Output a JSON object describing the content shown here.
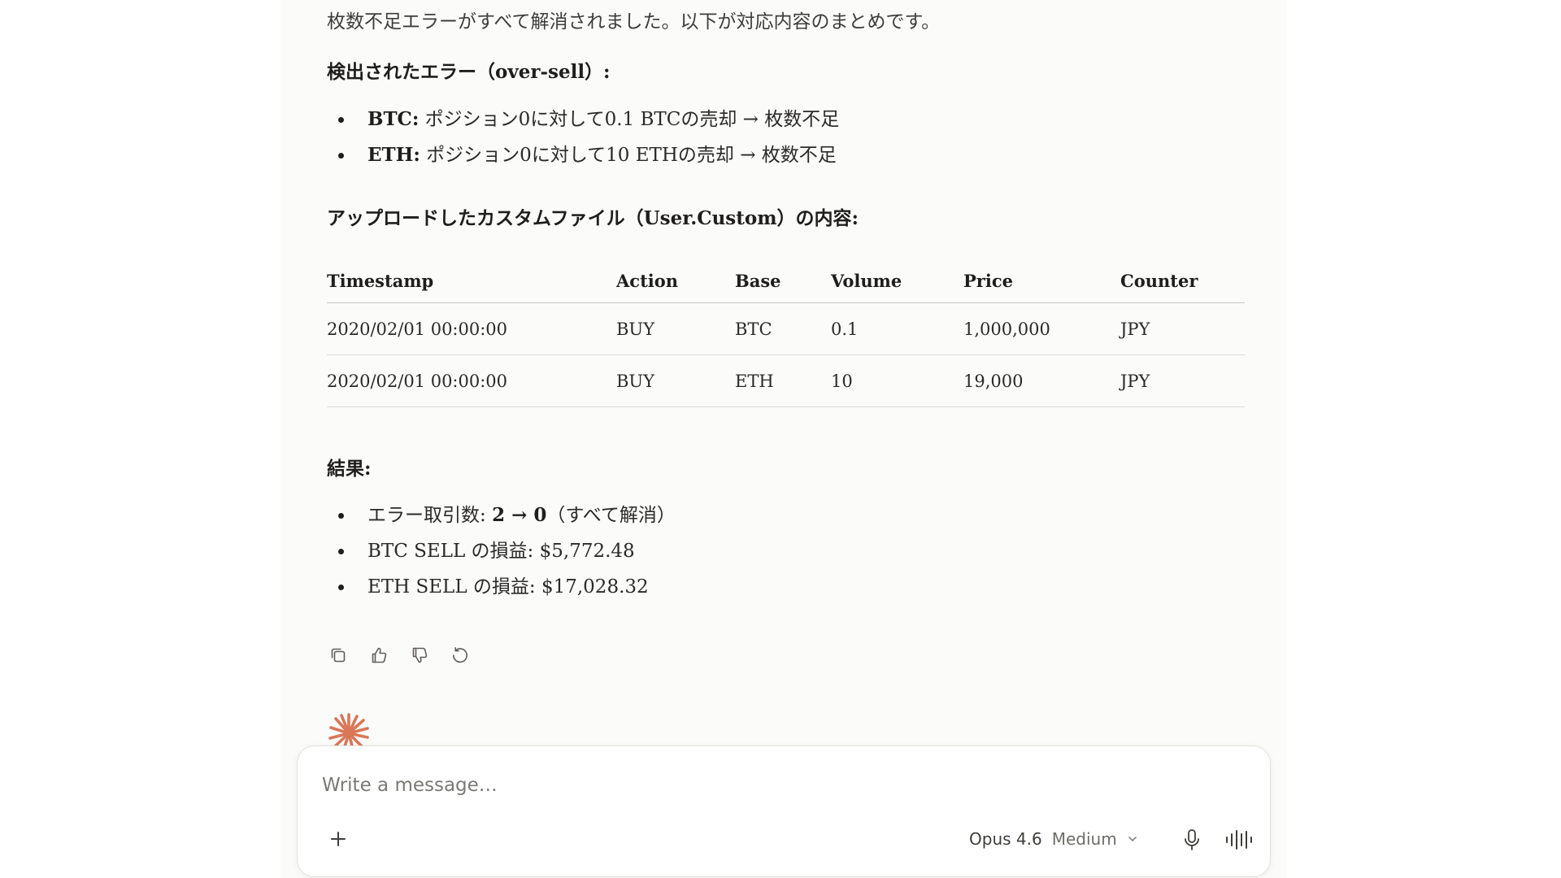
{
  "message": {
    "intro": "枚数不足エラーがすべて解消されました。以下が対応内容のまとめです。",
    "errors_heading": "検出されたエラー（over-sell）:",
    "errors": [
      {
        "label": "BTC:",
        "text": " ポジション0に対して0.1 BTCの売却 → 枚数不足"
      },
      {
        "label": "ETH:",
        "text": " ポジション0に対して10 ETHの売却 → 枚数不足"
      }
    ],
    "upload_heading": "アップロードしたカスタムファイル（User.Custom）の内容:",
    "table": {
      "headers": [
        "Timestamp",
        "Action",
        "Base",
        "Volume",
        "Price",
        "Counter"
      ],
      "rows": [
        [
          "2020/02/01 00:00:00",
          "BUY",
          "BTC",
          "0.1",
          "1,000,000",
          "JPY"
        ],
        [
          "2020/02/01 00:00:00",
          "BUY",
          "ETH",
          "10",
          "19,000",
          "JPY"
        ]
      ]
    },
    "result_heading": "結果:",
    "results": [
      {
        "prefix": "エラー取引数: ",
        "strong": "2 → 0",
        "suffix": "（すべて解消）"
      },
      {
        "prefix": "BTC SELL の損益: $5,772.48",
        "strong": "",
        "suffix": ""
      },
      {
        "prefix": "ETH SELL の損益: $17,028.32",
        "strong": "",
        "suffix": ""
      }
    ]
  },
  "action_icons": [
    "copy-icon",
    "thumbs-up-icon",
    "thumbs-down-icon",
    "retry-icon"
  ],
  "composer": {
    "placeholder": "Write a message…",
    "model_name": "Opus 4.6",
    "effort": "Medium"
  },
  "colors": {
    "accent": "#d97757",
    "text": "#1f1e1d",
    "muted": "#6e6d69",
    "column_bg": "#fbfbfa"
  }
}
